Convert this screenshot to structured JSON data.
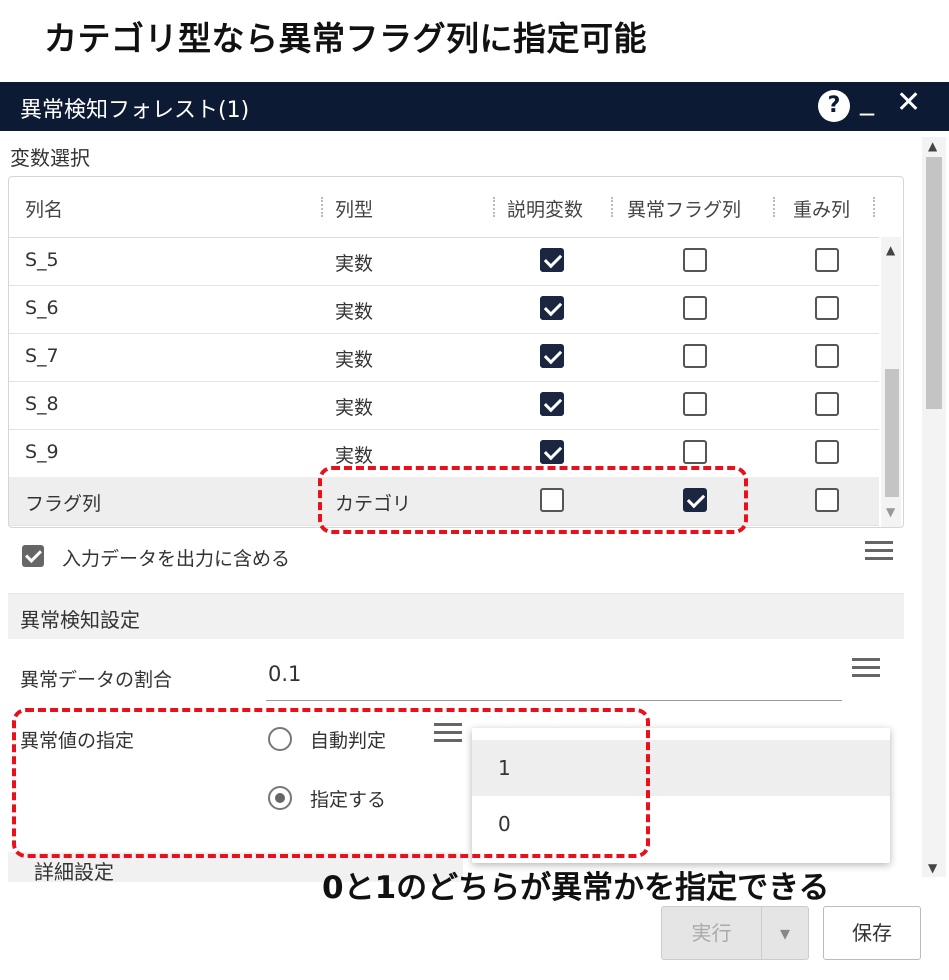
{
  "heading": "カテゴリ型なら異常フラグ列に指定可能",
  "window": {
    "title": "異常検知フォレスト(1)",
    "help_icon": "?",
    "minimize_icon": "_",
    "close_icon": "✕"
  },
  "variable_selection": {
    "label": "変数選択",
    "columns": [
      "列名",
      "列型",
      "説明変数",
      "異常フラグ列",
      "重み列"
    ],
    "rows": [
      {
        "name": "S_5",
        "type": "実数",
        "explanatory": true,
        "anomaly_flag": false,
        "weight": false
      },
      {
        "name": "S_6",
        "type": "実数",
        "explanatory": true,
        "anomaly_flag": false,
        "weight": false
      },
      {
        "name": "S_7",
        "type": "実数",
        "explanatory": true,
        "anomaly_flag": false,
        "weight": false
      },
      {
        "name": "S_8",
        "type": "実数",
        "explanatory": true,
        "anomaly_flag": false,
        "weight": false
      },
      {
        "name": "S_9",
        "type": "実数",
        "explanatory": true,
        "anomaly_flag": false,
        "weight": false
      },
      {
        "name": "フラグ列",
        "type": "カテゴリ",
        "explanatory": false,
        "anomaly_flag": true,
        "weight": false
      }
    ]
  },
  "include_input": {
    "label": "入力データを出力に含める",
    "checked": true
  },
  "anomaly_settings": {
    "header": "異常検知設定",
    "ratio_label": "異常データの割合",
    "ratio_value": "0.1",
    "value_label": "異常値の指定",
    "options": [
      "自動判定",
      "指定する"
    ],
    "selected_option": "指定する",
    "dropdown_values": [
      "1",
      "0"
    ]
  },
  "details_label": "詳細設定",
  "annotation": "0と1のどちらが異常かを指定できる",
  "buttons": {
    "run": "実行",
    "save": "保存"
  },
  "colors": {
    "titlebar": "#0d1a33",
    "checked": "#1b2740",
    "highlight": "#e8101a"
  }
}
